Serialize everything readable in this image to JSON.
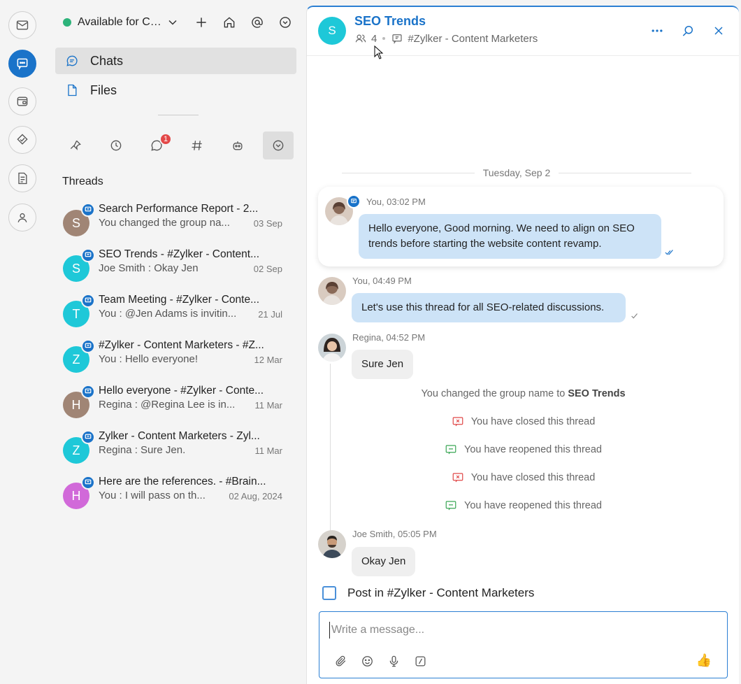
{
  "status": {
    "text": "Available for Chat",
    "color": "#2db37a"
  },
  "nav": [
    {
      "label": "Chats"
    },
    {
      "label": "Files"
    }
  ],
  "filters": {
    "unread_badge": "1"
  },
  "threads_section": {
    "title": "Threads"
  },
  "threads": [
    {
      "initial": "S",
      "color": "#a08575",
      "title": "Search Performance Report - 2...",
      "sub": "You changed the group na...",
      "date": "03 Sep"
    },
    {
      "initial": "S",
      "color": "#1ec8d8",
      "title": "SEO Trends - #Zylker - Content...",
      "sub": "Joe Smith : Okay Jen",
      "date": "02 Sep"
    },
    {
      "initial": "T",
      "color": "#1ec8d8",
      "title": "Team Meeting - #Zylker - Conte...",
      "sub": "You : @Jen Adams  is invitin...",
      "date": "21 Jul"
    },
    {
      "initial": "Z",
      "color": "#1ec8d8",
      "title": "#Zylker - Content Marketers - #Z...",
      "sub": "You : Hello everyone!",
      "date": "12 Mar"
    },
    {
      "initial": "H",
      "color": "#a08575",
      "title": "Hello everyone - #Zylker - Conte...",
      "sub": "Regina : @Regina Lee  is in...",
      "date": "11 Mar"
    },
    {
      "initial": "Z",
      "color": "#1ec8d8",
      "title": "Zylker - Content Marketers - Zyl...",
      "sub": "Regina : Sure Jen.",
      "date": "11 Mar"
    },
    {
      "initial": "H",
      "color": "#d169d9",
      "title": "Here are the references. - #Brain...",
      "sub": "You : I will pass on th...",
      "date": "02 Aug, 2024"
    }
  ],
  "chat": {
    "avatar_initial": "S",
    "title": "SEO Trends",
    "member_count": "4",
    "parent_channel": "#Zylker - Content Marketers",
    "date_separator": "Tuesday, Sep 2",
    "messages": [
      {
        "meta": "You, 03:02 PM",
        "text": "Hello everyone, Good morning. We need to align on SEO trends before starting the website content revamp."
      },
      {
        "meta": "You, 04:49 PM",
        "text": "Let's use this thread for all SEO-related discussions."
      },
      {
        "meta": "Regina, 04:52 PM",
        "text": "Sure Jen"
      },
      {
        "meta": "Joe Smith, 05:05 PM",
        "text": "Okay Jen"
      }
    ],
    "system": {
      "rename_prefix": "You changed the group name to",
      "rename_name": "SEO Trends",
      "events": [
        "You have closed this thread",
        "You have reopened this thread",
        "You have closed this thread",
        "You have reopened this thread"
      ]
    },
    "post_in_label": "Post in #Zylker - Content Marketers",
    "composer_placeholder": "Write a message..."
  },
  "icons": {
    "rail": [
      "mail-icon",
      "chat-icon",
      "cliq-icon",
      "tasks-icon",
      "notes-icon",
      "contacts-icon"
    ],
    "accent": "#1a73c9"
  }
}
